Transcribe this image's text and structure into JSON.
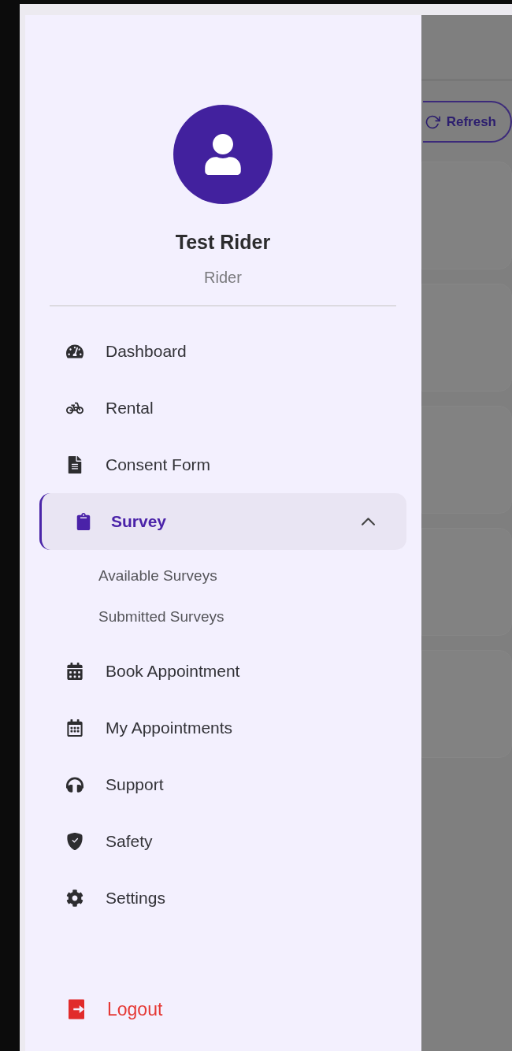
{
  "profile": {
    "name": "Test Rider",
    "role": "Rider"
  },
  "menu": [
    {
      "label": "Dashboard",
      "selected": false
    },
    {
      "label": "Rental",
      "selected": false
    },
    {
      "label": "Consent Form",
      "selected": false
    },
    {
      "label": "Survey",
      "selected": true,
      "expanded": true,
      "children": [
        {
          "label": "Available Surveys"
        },
        {
          "label": "Submitted Surveys"
        }
      ]
    },
    {
      "label": "Book Appointment",
      "selected": false
    },
    {
      "label": "My Appointments",
      "selected": false
    },
    {
      "label": "Support",
      "selected": false
    },
    {
      "label": "Safety",
      "selected": false
    },
    {
      "label": "Settings",
      "selected": false
    }
  ],
  "logout": {
    "label": "Logout"
  },
  "background": {
    "refresh_button": "Refresh"
  }
}
